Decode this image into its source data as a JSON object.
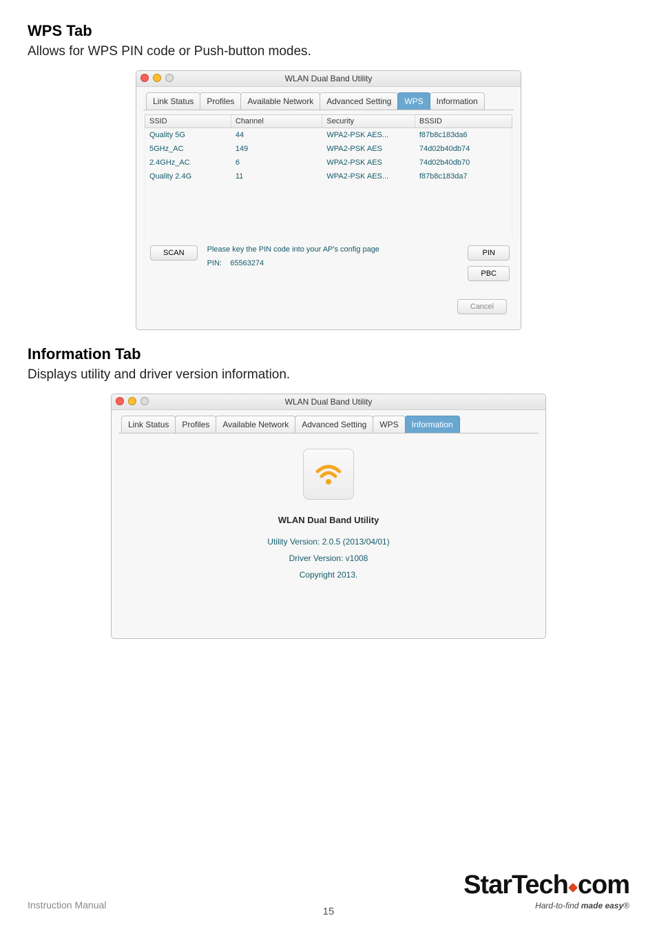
{
  "page": {
    "footer_text": "Instruction Manual",
    "page_number": "15",
    "brand_main": "StarTech",
    "brand_suffix": "com",
    "brand_tag_prefix": "Hard-to-find ",
    "brand_tag_em": "made easy",
    "brand_tag_tm": "®"
  },
  "sections": {
    "wps": {
      "title": "WPS Tab",
      "desc": "Allows for WPS PIN code or Push-button modes."
    },
    "info": {
      "title": "Information Tab",
      "desc": "Displays utility and driver version information."
    }
  },
  "window_common": {
    "title": "WLAN Dual Band Utility"
  },
  "tabs": {
    "link_status": "Link Status",
    "profiles": "Profiles",
    "available_network": "Available Network",
    "advanced_setting": "Advanced Setting",
    "wps": "WPS",
    "information": "Information"
  },
  "wps_window": {
    "headers": {
      "ssid": "SSID",
      "channel": "Channel",
      "security": "Security",
      "bssid": "BSSID"
    },
    "rows": [
      {
        "ssid": "Quality 5G",
        "channel": "44",
        "security": "WPA2-PSK AES...",
        "bssid": "f87b8c183da6"
      },
      {
        "ssid": "5GHz_AC",
        "channel": "149",
        "security": "WPA2-PSK AES",
        "bssid": "74d02b40db74"
      },
      {
        "ssid": "2.4GHz_AC",
        "channel": "6",
        "security": "WPA2-PSK AES",
        "bssid": "74d02b40db70"
      },
      {
        "ssid": "Quality 2.4G",
        "channel": "11",
        "security": "WPA2-PSK AES...",
        "bssid": "f87b8c183da7"
      }
    ],
    "scan_btn": "SCAN",
    "hint": "Please key the PIN code into your AP's config page",
    "pin_label": "PIN:",
    "pin_value": "65563274",
    "pin_btn": "PIN",
    "pbc_btn": "PBC",
    "cancel_btn": "Cancel"
  },
  "info_window": {
    "app_name": "WLAN Dual Band Utility",
    "utility_version": "Utility Version: 2.0.5 (2013/04/01)",
    "driver_version": "Driver Version: v1008",
    "copyright": "Copyright 2013."
  }
}
